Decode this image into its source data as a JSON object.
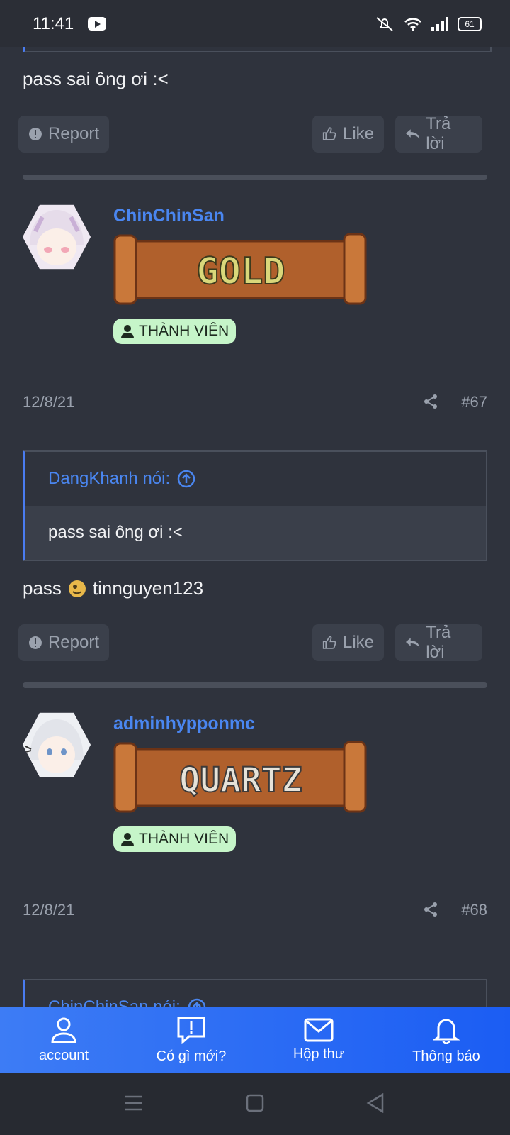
{
  "status": {
    "time": "11:41",
    "battery": "61"
  },
  "post_prev": {
    "text": "pass sai ông ơi :<",
    "report": "Report",
    "like": "Like",
    "reply": "Trả lời"
  },
  "post67": {
    "username": "ChinChinSan",
    "rank": "GOLD",
    "badge": "THÀNH VIÊN",
    "date": "12/8/21",
    "number": "#67",
    "quote_author": "DangKhanh nói:",
    "quote_text": "pass sai ông ơi :<",
    "text_before": "pass",
    "text_after": "tinnguyen123",
    "report": "Report",
    "like": "Like",
    "reply": "Trả lời"
  },
  "post68": {
    "username": "adminhypponmc",
    "rank": "QUARTZ",
    "badge": "THÀNH VIÊN",
    "date": "12/8/21",
    "number": "#68",
    "quote_author": "ChinChinSan nói:"
  },
  "navbar": {
    "items": [
      {
        "label": "account",
        "icon": "user-icon"
      },
      {
        "label": "Có gì mới?",
        "icon": "alert-message-icon"
      },
      {
        "label": "Hộp thư",
        "icon": "mail-icon"
      },
      {
        "label": "Thông báo",
        "icon": "bell-icon"
      }
    ]
  },
  "colors": {
    "accent": "#4a86f0",
    "background": "#2f333d",
    "badge": "#c6f5c9"
  }
}
